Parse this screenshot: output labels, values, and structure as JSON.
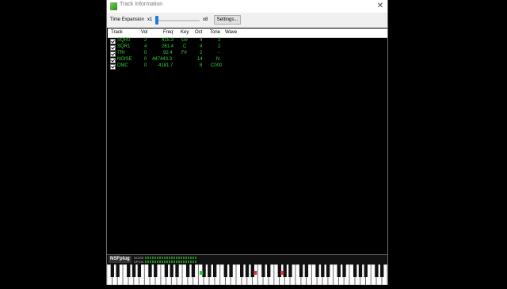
{
  "window": {
    "title": "Track Information",
    "close_glyph": "✕",
    "accent_color": "#1e79d9"
  },
  "toolbar": {
    "time_expansion_label": "Time Expansion",
    "min_label": "x1",
    "max_label": "x8",
    "slider_value": 1,
    "settings_label": "Settings..."
  },
  "table": {
    "columns": [
      "Track",
      "Vol",
      "Freq",
      "Key",
      "Oct",
      "Tone",
      "Wave"
    ],
    "rows": [
      {
        "track": "SQR0",
        "vol": "2",
        "freq": "415.3",
        "key": "G#",
        "oct": "4",
        "tone": "2",
        "wave": ""
      },
      {
        "track": "SQR1",
        "vol": "4",
        "freq": "261.4",
        "key": "C",
        "oct": "4",
        "tone": "2",
        "wave": ""
      },
      {
        "track": "TRI",
        "vol": "0",
        "freq": "92.4",
        "key": "F#",
        "oct": "2",
        "tone": "-",
        "wave": ""
      },
      {
        "track": "NOISE",
        "vol": "0",
        "freq": "447443.3",
        "key": "",
        "oct": "14",
        "tone": "N",
        "wave": ""
      },
      {
        "track": "DMC",
        "vol": "0",
        "freq": "4181.7",
        "key": "",
        "oct": "8",
        "tone": "C000",
        "wave": ""
      }
    ],
    "text_color": "#3cd23c"
  },
  "footer": {
    "logo": "NSFplug",
    "meter_labels": [
      "NOISE",
      "DPCM"
    ]
  },
  "piano": {
    "highlight_colors": [
      "#2fbf3a",
      "#d23a3a"
    ]
  }
}
